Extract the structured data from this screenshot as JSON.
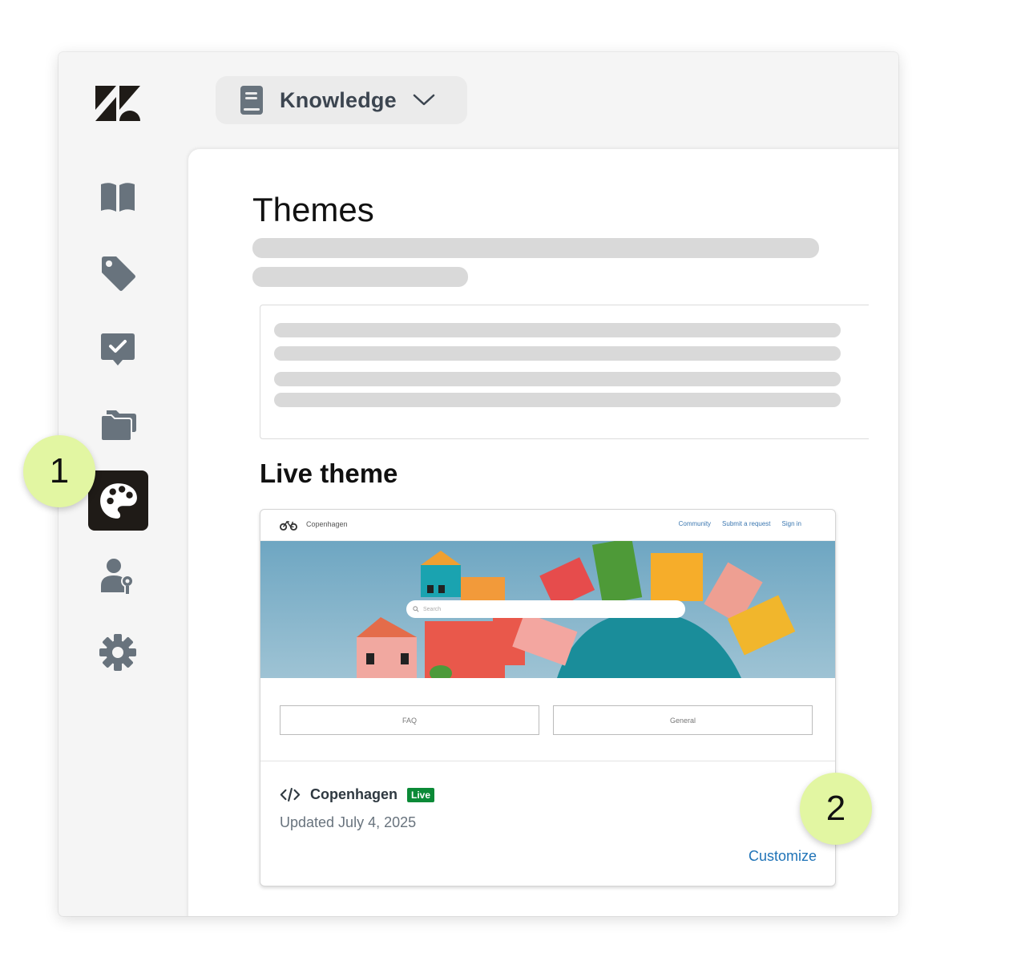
{
  "switcher": {
    "label": "Knowledge"
  },
  "sidebar": {
    "items": [
      {
        "icon": "book-open-icon"
      },
      {
        "icon": "tag-icon"
      },
      {
        "icon": "checkmark-message-icon"
      },
      {
        "icon": "folders-icon"
      },
      {
        "icon": "palette-icon",
        "active": true
      },
      {
        "icon": "user-key-icon"
      },
      {
        "icon": "gear-icon"
      }
    ]
  },
  "main": {
    "title": "Themes",
    "live_theme_heading": "Live theme",
    "preview": {
      "brand": "Copenhagen",
      "nav": [
        "Community",
        "Submit a request",
        "Sign in"
      ],
      "search_placeholder": "Search",
      "categories": [
        "FAQ",
        "General"
      ]
    },
    "theme": {
      "name": "Copenhagen",
      "badge": "Live",
      "updated": "Updated July 4, 2025",
      "customize_label": "Customize"
    }
  },
  "callouts": [
    "1",
    "2"
  ],
  "colors": {
    "accent_link": "#1f73b7",
    "live_badge": "#0b8a37",
    "callout": "#e2f6a2",
    "active_nav": "#1f1b17"
  }
}
